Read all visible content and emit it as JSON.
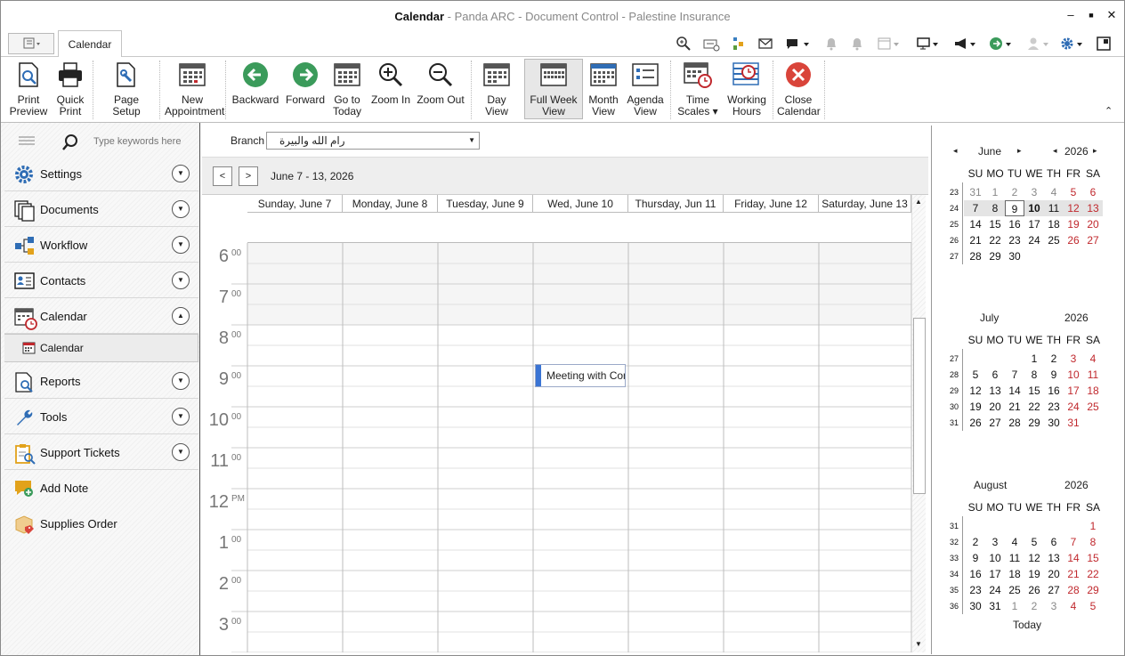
{
  "window": {
    "title_main": "Calendar",
    "title_rest": " - Panda ARC - Document Control - Palestine Insurance",
    "minimize": "–",
    "maximize": "■",
    "close": "✕"
  },
  "ribbon_tab": "Calendar",
  "ribbon": {
    "print_preview": "Print Preview",
    "quick_print": "Quick Print",
    "page_setup": "Page Setup",
    "new_appointment": "New Appointment",
    "backward": "Backward",
    "forward": "Forward",
    "go_to_today": "Go to Today",
    "zoom_in": "Zoom In",
    "zoom_out": "Zoom Out",
    "day_view": "Day View",
    "full_week_view": "Full Week View",
    "month_view": "Month View",
    "agenda_view": "Agenda View",
    "time_scales": "Time Scales",
    "working_hours": "Working Hours",
    "close_calendar": "Close Calendar"
  },
  "sidebar": {
    "search_placeholder": "Type keywords here",
    "items": [
      {
        "label": "Settings",
        "icon": "gear-icon"
      },
      {
        "label": "Documents",
        "icon": "documents-icon"
      },
      {
        "label": "Workflow",
        "icon": "workflow-icon"
      },
      {
        "label": "Contacts",
        "icon": "contacts-icon"
      },
      {
        "label": "Calendar",
        "icon": "calendar-icon"
      },
      {
        "label": "Calendar",
        "icon": "calendar-small-icon"
      },
      {
        "label": "Reports",
        "icon": "reports-icon"
      },
      {
        "label": "Tools",
        "icon": "wrench-icon"
      },
      {
        "label": "Support Tickets",
        "icon": "support-ticket-icon"
      },
      {
        "label": "Add Note",
        "icon": "add-note-icon"
      },
      {
        "label": "Supplies Order",
        "icon": "supplies-order-icon"
      }
    ]
  },
  "branch": {
    "label": "Branch",
    "value": "رام الله والبيرة"
  },
  "date_range": "June 7 - 13, 2026",
  "columns": [
    "Sunday, June 7",
    "Monday, June 8",
    "Tuesday, June 9",
    "Wed, June 10",
    "Thursday, Jun 11",
    "Friday, June 12",
    "Saturday, June 13"
  ],
  "hours": [
    {
      "h": "6",
      "m": "00"
    },
    {
      "h": "7",
      "m": "00"
    },
    {
      "h": "8",
      "m": "00"
    },
    {
      "h": "9",
      "m": "00"
    },
    {
      "h": "10",
      "m": "00"
    },
    {
      "h": "11",
      "m": "00"
    },
    {
      "h": "12",
      "m": "PM"
    },
    {
      "h": "1",
      "m": "00"
    },
    {
      "h": "2",
      "m": "00"
    },
    {
      "h": "3",
      "m": "00"
    }
  ],
  "appointment": "Meeting with Com",
  "mini_calendars": {
    "dow": [
      "SU",
      "MO",
      "TU",
      "WE",
      "TH",
      "FR",
      "SA"
    ],
    "june": {
      "month": "June",
      "year": "2026",
      "prev": "◂",
      "next": "▸",
      "weeks": [
        "23",
        "24",
        "25",
        "26",
        "27"
      ],
      "rows": [
        [
          "31",
          "1",
          "2",
          "3",
          "4",
          "5",
          "6"
        ],
        [
          "7",
          "8",
          "9",
          "10",
          "11",
          "12",
          "13"
        ],
        [
          "14",
          "15",
          "16",
          "17",
          "18",
          "19",
          "20"
        ],
        [
          "21",
          "22",
          "23",
          "24",
          "25",
          "26",
          "27"
        ],
        [
          "28",
          "29",
          "30",
          "",
          "",
          "",
          ""
        ]
      ]
    },
    "july": {
      "month": "July",
      "year": "2026",
      "weeks": [
        "27",
        "28",
        "29",
        "30",
        "31"
      ],
      "rows": [
        [
          "",
          "",
          "",
          "1",
          "2",
          "3",
          "4"
        ],
        [
          "5",
          "6",
          "7",
          "8",
          "9",
          "10",
          "11"
        ],
        [
          "12",
          "13",
          "14",
          "15",
          "16",
          "17",
          "18"
        ],
        [
          "19",
          "20",
          "21",
          "22",
          "23",
          "24",
          "25"
        ],
        [
          "26",
          "27",
          "28",
          "29",
          "30",
          "31",
          ""
        ]
      ]
    },
    "august": {
      "month": "August",
      "year": "2026",
      "weeks": [
        "31",
        "32",
        "33",
        "34",
        "35",
        "36"
      ],
      "rows": [
        [
          "",
          "",
          "",
          "",
          "",
          "",
          "1"
        ],
        [
          "2",
          "3",
          "4",
          "5",
          "6",
          "7",
          "8"
        ],
        [
          "9",
          "10",
          "11",
          "12",
          "13",
          "14",
          "15"
        ],
        [
          "16",
          "17",
          "18",
          "19",
          "20",
          "21",
          "22"
        ],
        [
          "23",
          "24",
          "25",
          "26",
          "27",
          "28",
          "29"
        ],
        [
          "30",
          "31",
          "1",
          "2",
          "3",
          "4",
          "5"
        ]
      ]
    },
    "today_label": "Today"
  },
  "colors": {
    "accent_blue": "#2f6db5",
    "weekend_red": "#c0282d",
    "appointment_bar": "#3a74d4"
  }
}
